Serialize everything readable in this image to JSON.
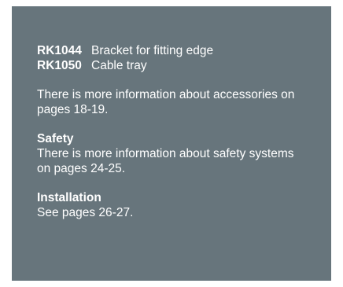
{
  "accessories": [
    {
      "code": "RK1044",
      "description": "Bracket for fitting edge"
    },
    {
      "code": "RK1050",
      "description": "Cable tray"
    }
  ],
  "accessories_info": "There is more information about accessories on pages 18-19.",
  "safety": {
    "heading": "Safety",
    "text": "There is more information about safety systems on pages 24-25."
  },
  "installation": {
    "heading": "Installation",
    "text": "See pages 26-27."
  },
  "colors": {
    "panel_background": "#67757c",
    "text": "#ffffff"
  }
}
